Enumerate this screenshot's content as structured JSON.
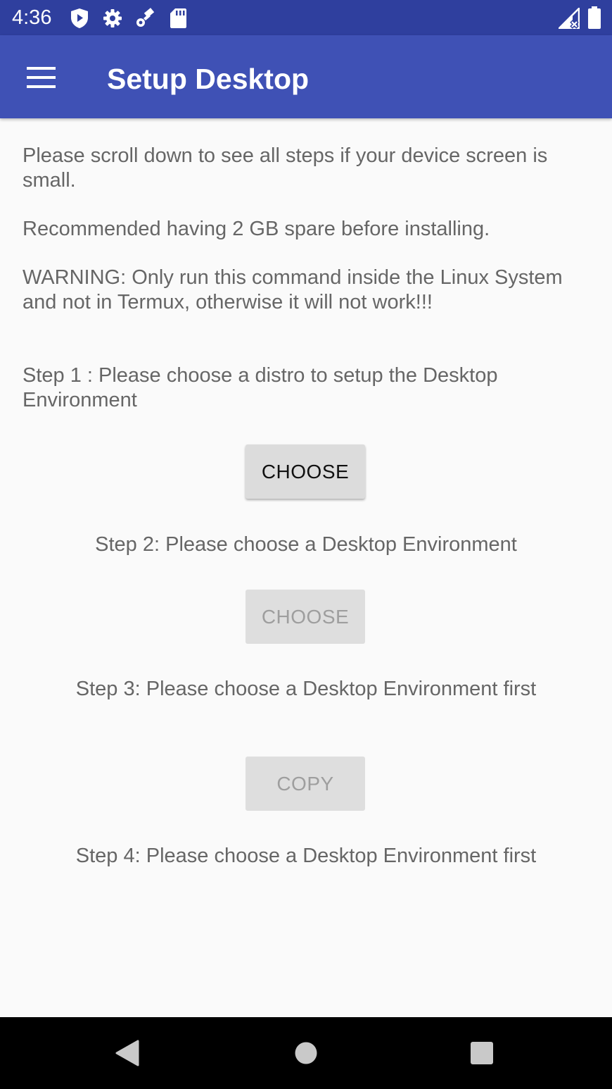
{
  "status_bar": {
    "time": "4:36",
    "icons": [
      "shield-icon",
      "gear-icon",
      "satellite-icon",
      "sd-card-icon",
      "signal-icon",
      "battery-icon"
    ]
  },
  "app_bar": {
    "title": "Setup Desktop",
    "menu_icon": "hamburger-menu-icon",
    "background": "#3f51b5"
  },
  "content": {
    "intro": "Please scroll down to see all steps if your device screen is small.",
    "recommend": "Recommended having 2 GB spare before installing.",
    "warning": "WARNING: Only run this command inside the Linux System and not in Termux, otherwise it will not work!!!",
    "step1_text": "Step 1 : Please choose a distro to setup the Desktop Environment",
    "step1_button": "CHOOSE",
    "step2_text": "Step 2: Please choose a Desktop Environment",
    "step2_button": "CHOOSE",
    "step3_text": "Step 3: Please choose a Desktop Environment first",
    "step3_button": "COPY",
    "step4_text": "Step 4: Please choose a Desktop Environment first"
  },
  "nav_bar": {
    "icons": [
      "back-icon",
      "home-icon",
      "recents-icon"
    ]
  }
}
